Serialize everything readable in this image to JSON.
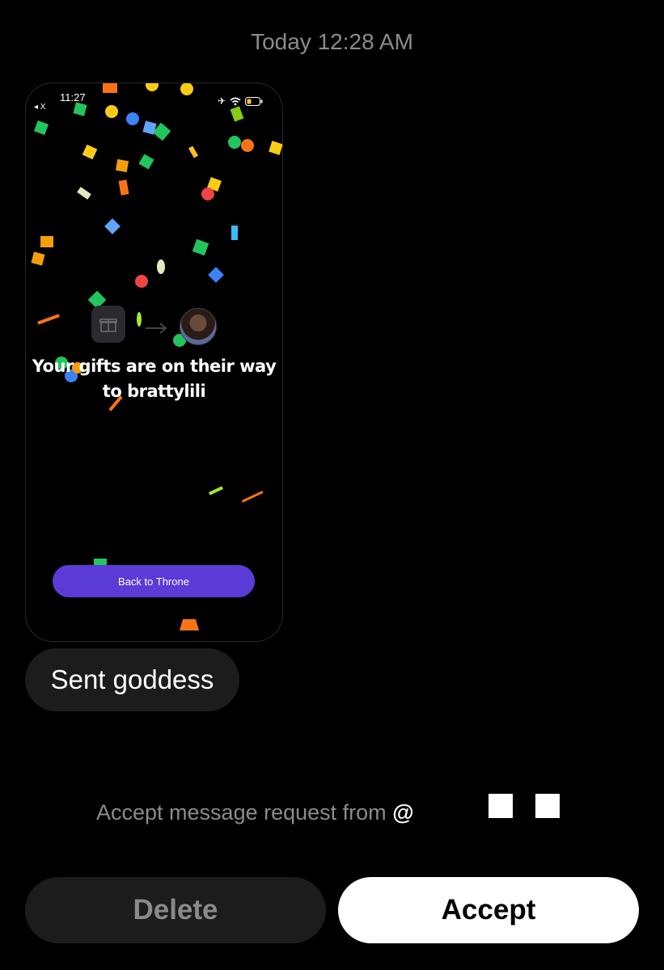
{
  "timestamp": "Today 12:28 AM",
  "screenshot": {
    "status_time": "11:27",
    "status_back": "◂ X",
    "headline": "Your gifts are on their way to brattylili",
    "back_button_label": "Back to Throne",
    "button_color": "#5b3bd6"
  },
  "message": {
    "text": "Sent goddess"
  },
  "request": {
    "prefix": "Accept message request from",
    "at": "@"
  },
  "actions": {
    "delete_label": "Delete",
    "accept_label": "Accept"
  }
}
